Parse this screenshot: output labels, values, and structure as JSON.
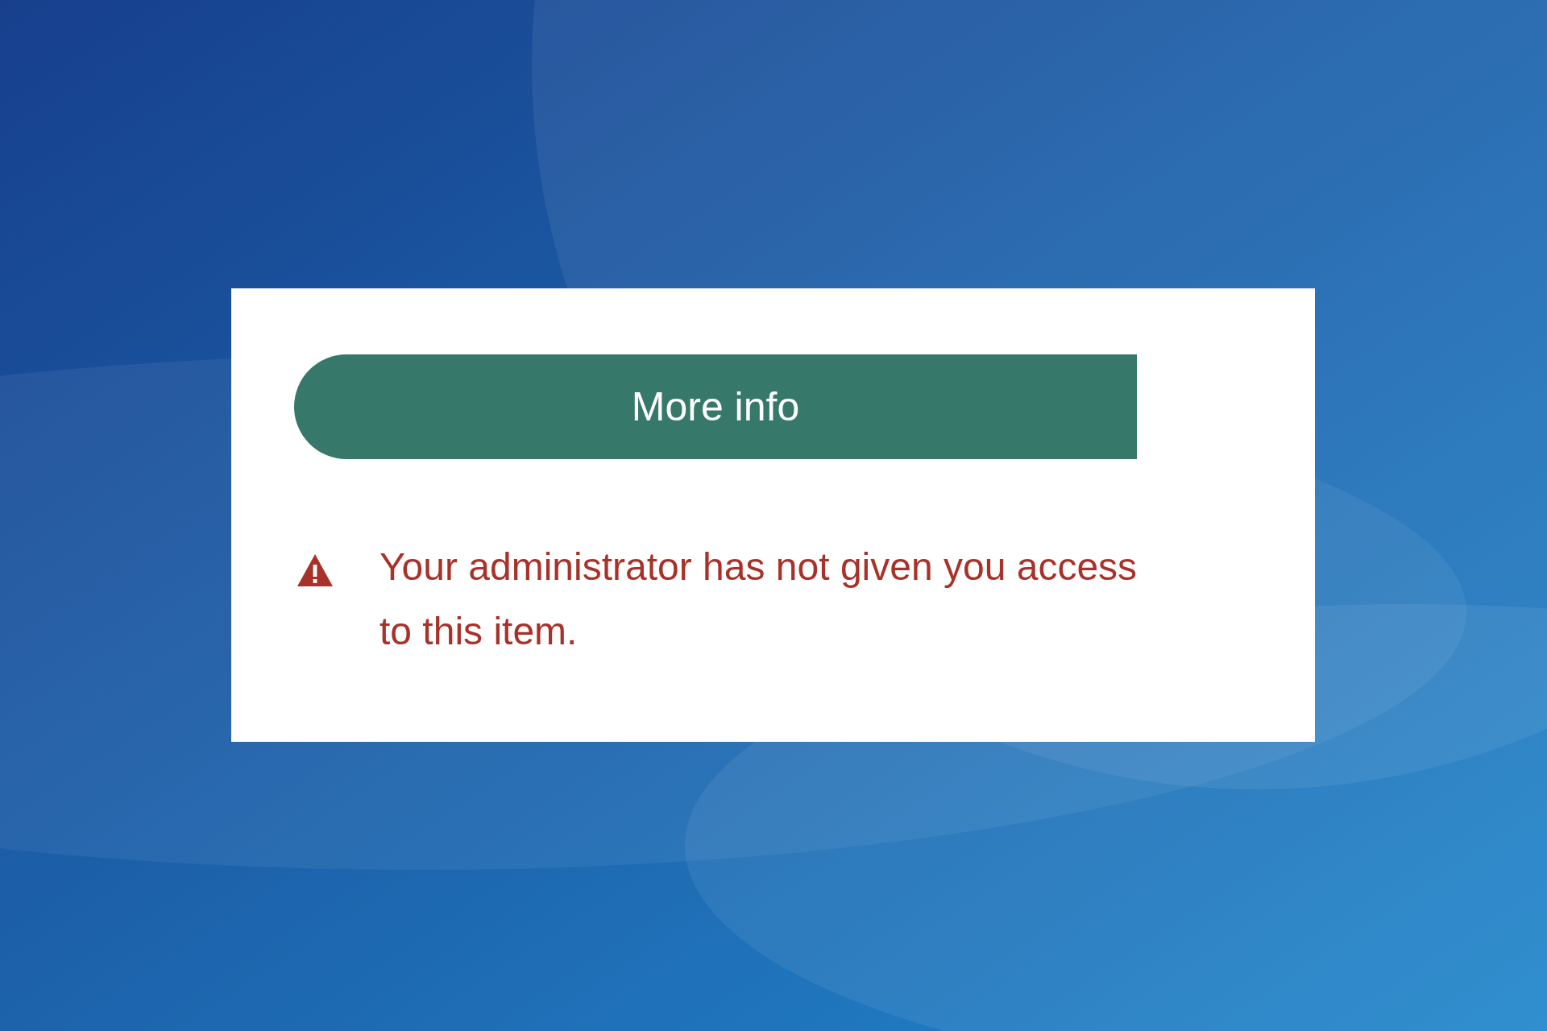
{
  "button": {
    "label": "More info"
  },
  "warning": {
    "message": "Your administrator has not given you access to this item."
  }
}
